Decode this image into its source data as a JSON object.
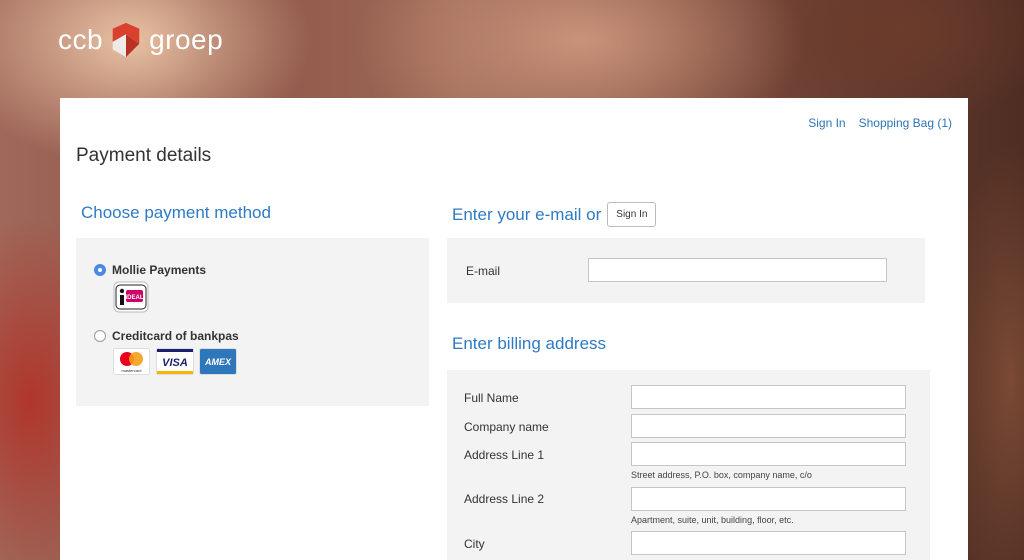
{
  "brand": {
    "left": "ccb",
    "right": "groep",
    "mark_color": "#d9412e"
  },
  "toplinks": {
    "sign_in": "Sign In",
    "shopping_bag": "Shopping Bag (1)"
  },
  "page_title": "Payment details",
  "payment": {
    "heading": "Choose payment method",
    "options": [
      {
        "label": "Mollie Payments",
        "selected": true,
        "logos": [
          "ideal-icon"
        ]
      },
      {
        "label": "Creditcard of bankpas",
        "selected": false,
        "logos": [
          "mastercard-icon",
          "visa-icon",
          "amex-icon"
        ]
      }
    ],
    "ideal_text": "iDEAL",
    "visa_text": "VISA",
    "amex_text": "AMEX",
    "mastercard_text": "mastercard"
  },
  "email_section": {
    "heading": "Enter your e-mail or",
    "sign_in_button": "Sign In",
    "email_label": "E-mail",
    "email_value": ""
  },
  "billing": {
    "heading": "Enter billing address",
    "fields": [
      {
        "label": "Full Name",
        "value": "",
        "hint": ""
      },
      {
        "label": "Company name",
        "value": "",
        "hint": ""
      },
      {
        "label": "Address Line 1",
        "value": "",
        "hint": "Street address, P.O. box, company name, c/o"
      },
      {
        "label": "Address Line 2",
        "value": "",
        "hint": "Apartment, suite, unit, building, floor, etc."
      },
      {
        "label": "City",
        "value": "",
        "hint": ""
      }
    ]
  },
  "colors": {
    "accent": "#2e7bc4",
    "link": "#2e74b5",
    "panel_bg": "#f3f3f3"
  }
}
